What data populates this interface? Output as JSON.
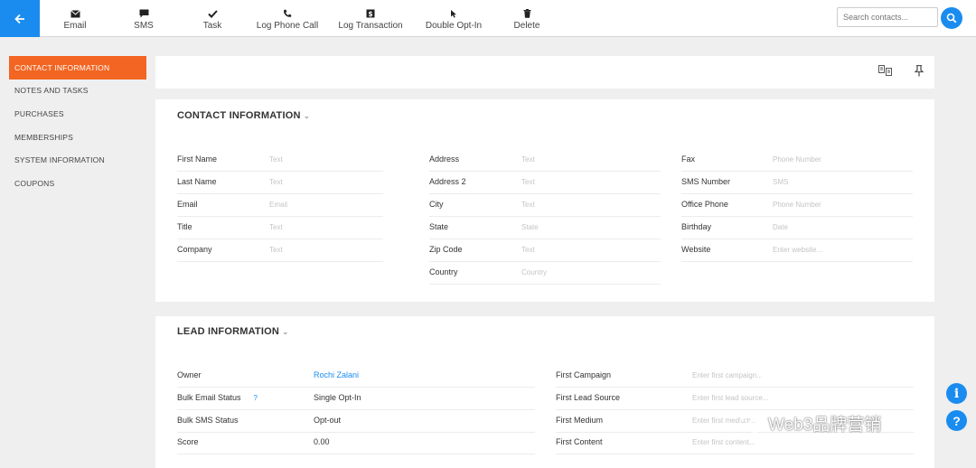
{
  "toolbar": {
    "back_icon": "arrow-left-icon",
    "email": "Email",
    "sms": "SMS",
    "task": "Task",
    "log_call": "Log Phone Call",
    "log_transaction": "Log Transaction",
    "double_optin": "Double Opt-In",
    "delete": "Delete",
    "search_placeholder": "Search contacts..."
  },
  "sidebar": {
    "items": [
      {
        "label": "CONTACT INFORMATION"
      },
      {
        "label": "NOTES AND TASKS"
      },
      {
        "label": "PURCHASES"
      },
      {
        "label": "MEMBERSHIPS"
      },
      {
        "label": "SYSTEM INFORMATION"
      },
      {
        "label": "COUPONS"
      }
    ]
  },
  "contact": {
    "title": "CONTACT INFORMATION",
    "col1": [
      {
        "k": "First Name",
        "v": "Text"
      },
      {
        "k": "Last Name",
        "v": "Text"
      },
      {
        "k": "Email",
        "v": "Email"
      },
      {
        "k": "Title",
        "v": "Text"
      },
      {
        "k": "Company",
        "v": "Text"
      }
    ],
    "col2": [
      {
        "k": "Address",
        "v": "Text"
      },
      {
        "k": "Address 2",
        "v": "Text"
      },
      {
        "k": "City",
        "v": "Text"
      },
      {
        "k": "State",
        "v": "State"
      },
      {
        "k": "Zip Code",
        "v": "Text"
      },
      {
        "k": "Country",
        "v": "Country"
      }
    ],
    "col3": [
      {
        "k": "Fax",
        "v": "Phone Number"
      },
      {
        "k": "SMS Number",
        "v": "SMS"
      },
      {
        "k": "Office Phone",
        "v": "Phone Number"
      },
      {
        "k": "Birthday",
        "v": "Date"
      },
      {
        "k": "Website",
        "v": "Enter website..."
      }
    ]
  },
  "lead": {
    "title": "LEAD INFORMATION",
    "col1": [
      {
        "k": "Owner",
        "v": "Rochi Zalani"
      },
      {
        "k": "Bulk Email Status",
        "v": "Single Opt-In",
        "help": "?"
      },
      {
        "k": "Bulk SMS Status",
        "v": "Opt-out"
      },
      {
        "k": "Score",
        "v": "0.00"
      }
    ],
    "col2": [
      {
        "k": "First Campaign",
        "v": "Enter first campaign..."
      },
      {
        "k": "First Lead Source",
        "v": "Enter first lead source..."
      },
      {
        "k": "First Medium",
        "v": "Enter first medium..."
      },
      {
        "k": "First Content",
        "v": "Enter first content..."
      }
    ]
  },
  "watermark": "Web3品牌营销",
  "colors": {
    "accent": "#1a8cf0",
    "active": "#f26522"
  }
}
